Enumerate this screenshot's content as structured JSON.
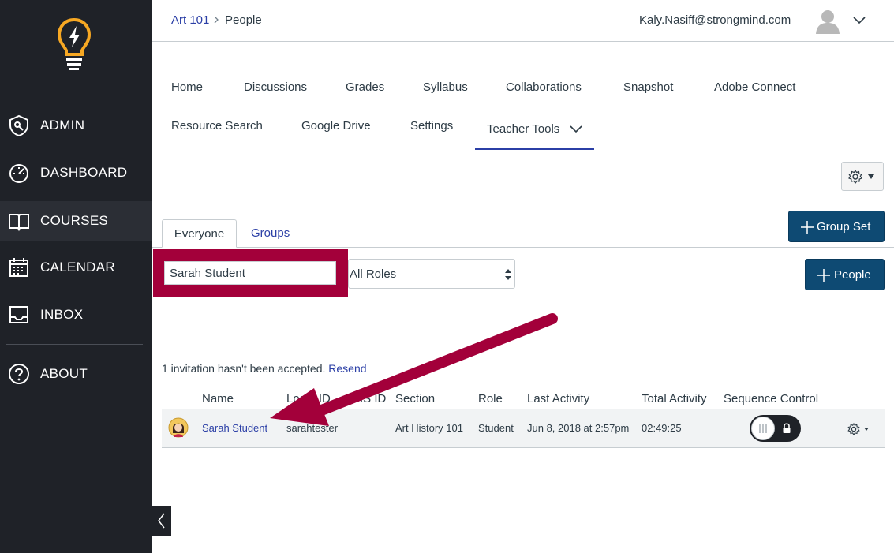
{
  "sidebar": {
    "items": [
      {
        "label": "ADMIN",
        "icon": "shield-icon"
      },
      {
        "label": "DASHBOARD",
        "icon": "speedometer-icon"
      },
      {
        "label": "COURSES",
        "icon": "book-icon",
        "active": true
      },
      {
        "label": "CALENDAR",
        "icon": "calendar-icon"
      },
      {
        "label": "INBOX",
        "icon": "inbox-icon"
      }
    ],
    "about": {
      "label": "ABOUT",
      "icon": "question-icon"
    }
  },
  "breadcrumb": {
    "course": "Art 101",
    "current": "People"
  },
  "user": {
    "email": "Kaly.Nasiff@strongmind.com"
  },
  "course_nav": {
    "row1": [
      "Home",
      "Discussions",
      "Grades",
      "Syllabus",
      "Collaborations",
      "Snapshot",
      "Adobe Connect"
    ],
    "row2": [
      "Resource Search",
      "Google Drive",
      "Settings",
      "Teacher Tools"
    ]
  },
  "buttons": {
    "group_set": "Group Set",
    "people": "People"
  },
  "tabs": {
    "everyone": "Everyone",
    "groups": "Groups"
  },
  "filters": {
    "search_value": "Sarah Student",
    "role": "All Roles"
  },
  "invitation": {
    "text": "1 invitation hasn't been accepted.",
    "link": "Resend"
  },
  "table": {
    "headers": [
      "Name",
      "Login ID",
      "SIS ID",
      "Section",
      "Role",
      "Last Activity",
      "Total Activity",
      "Sequence Control"
    ],
    "rows": [
      {
        "name": "Sarah Student",
        "login": "sarahtester",
        "sis": "",
        "section": "Art History 101",
        "role": "Student",
        "last": "Jun 8, 2018 at 2:57pm",
        "total": "02:49:25"
      }
    ]
  },
  "colors": {
    "accent": "#a3003a",
    "brand_blue": "#0e4a73",
    "sidebar": "#1f2228",
    "link": "#2b3fa6"
  }
}
